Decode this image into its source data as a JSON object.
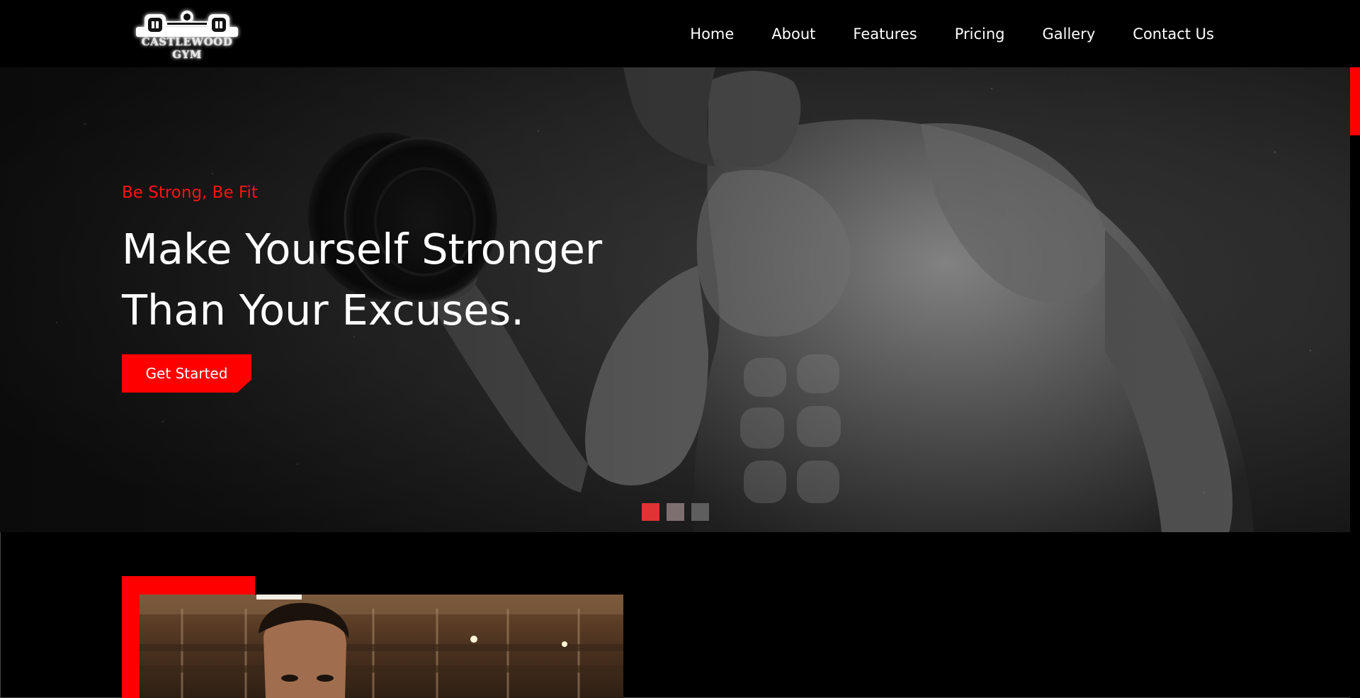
{
  "brand": {
    "logo_text": "CASTLEWOOD GYM"
  },
  "nav": {
    "items": [
      {
        "label": "Home"
      },
      {
        "label": "About"
      },
      {
        "label": "Features"
      },
      {
        "label": "Pricing"
      },
      {
        "label": "Gallery"
      },
      {
        "label": "Contact Us"
      }
    ]
  },
  "hero": {
    "tagline": "Be Strong, Be Fit",
    "title_line1": "Make Yourself Stronger",
    "title_line2": "Than Your Excuses.",
    "cta_label": "Get Started",
    "slides": [
      {
        "active": true
      },
      {
        "active": false
      },
      {
        "active": false
      }
    ]
  },
  "colors": {
    "accent": "#ff0000",
    "tagline": "#ff1212",
    "dot_active": "#e03333",
    "dot_inactive": "#7d6f6f",
    "dot_dim": "#5e5e5e",
    "background": "#000000"
  },
  "icons": {
    "logo": "dumbbell-logo-icon",
    "hero_image": "bodybuilder-curling-dumbbell-photo",
    "about_image": "man-in-gym-photo"
  }
}
